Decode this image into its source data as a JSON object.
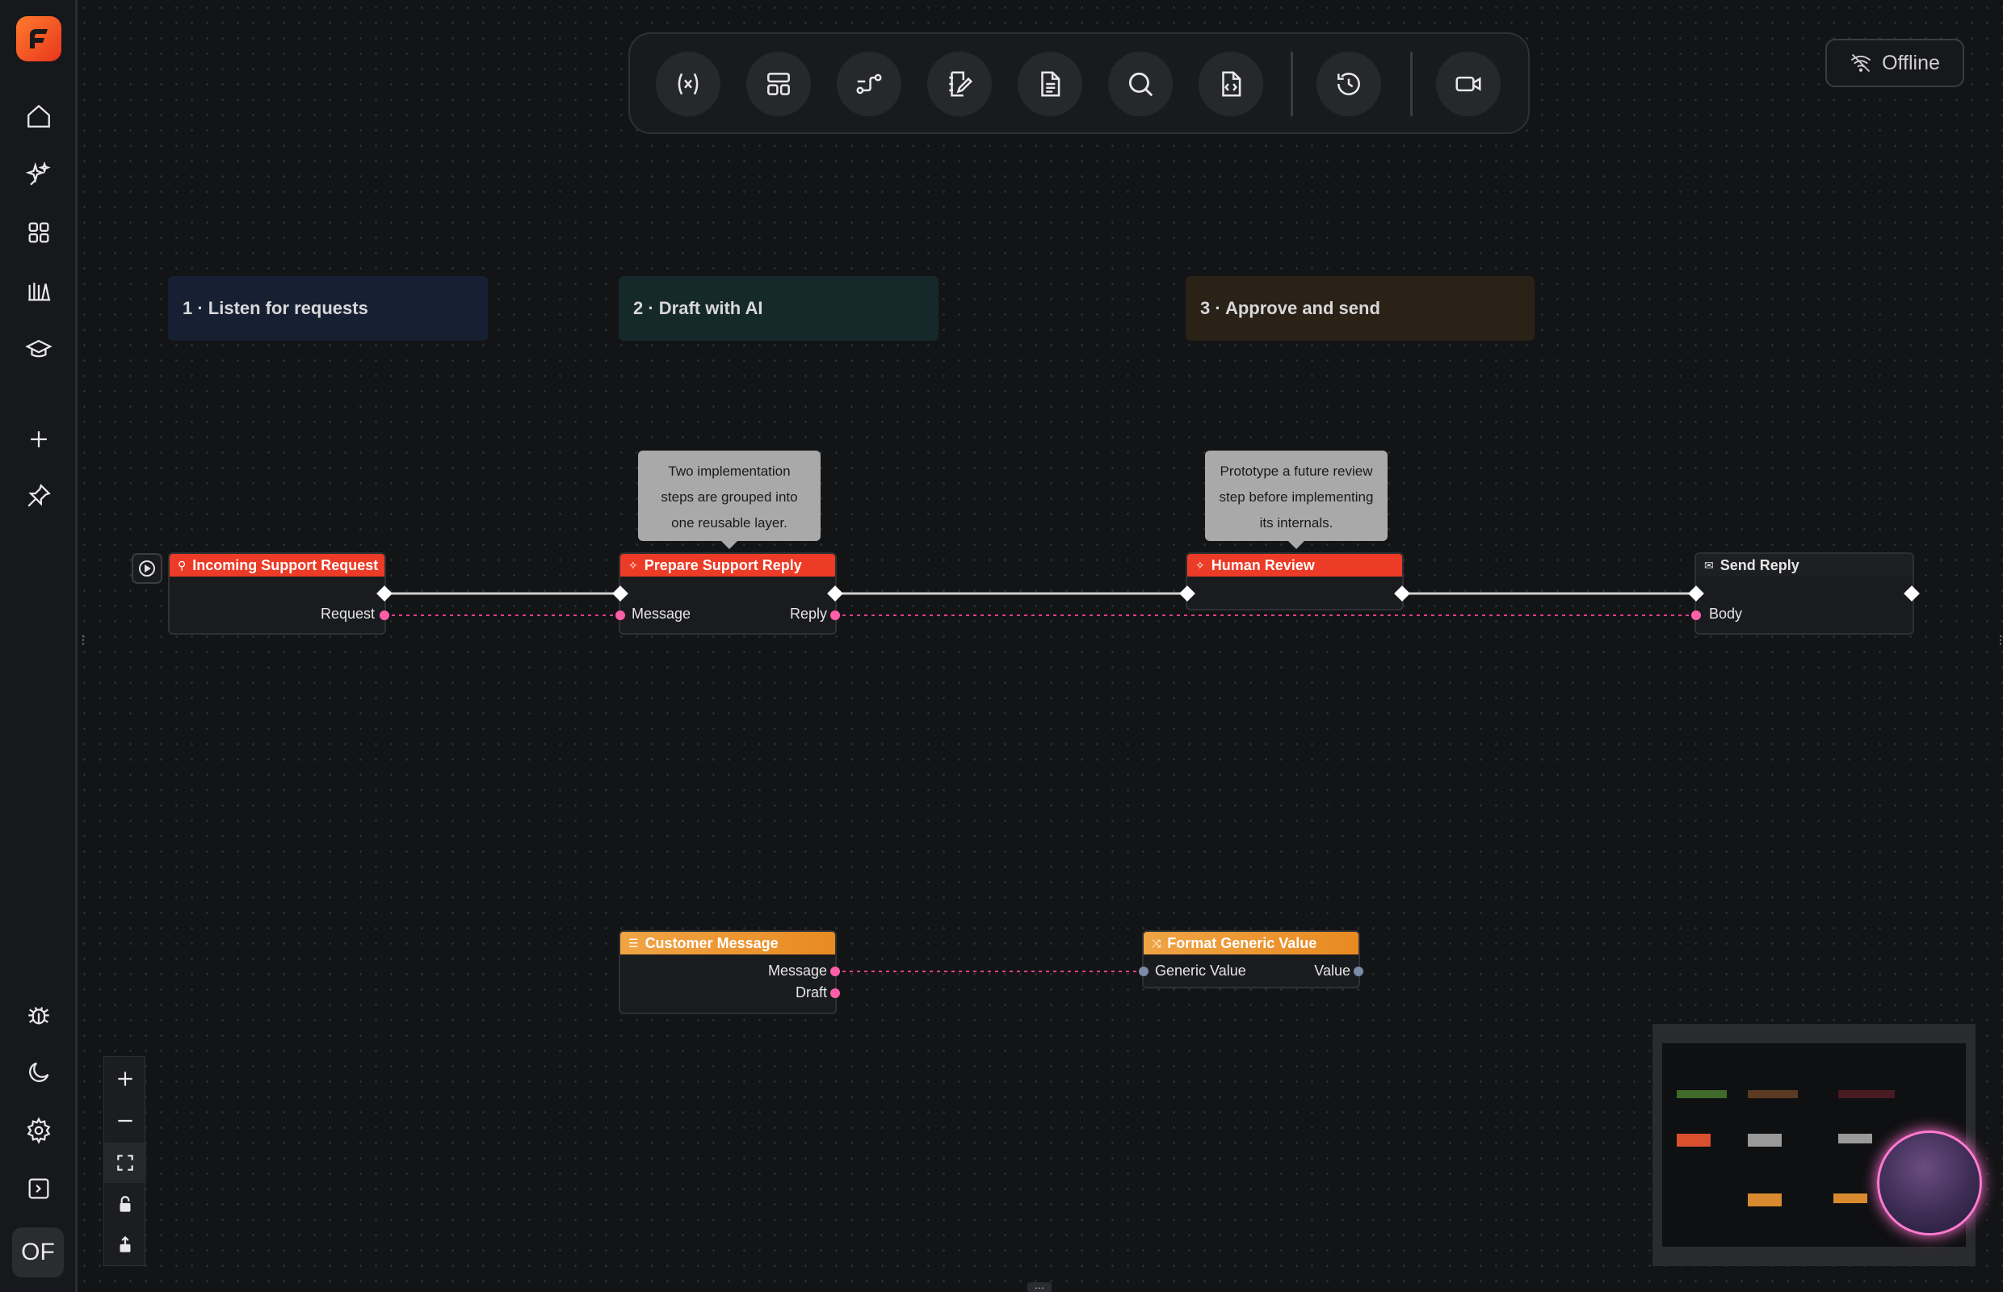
{
  "sidebar": {
    "items": [
      {
        "icon": "home-icon",
        "label": "Home"
      },
      {
        "icon": "sparkles-icon",
        "label": "AI"
      },
      {
        "icon": "grid-icon",
        "label": "Apps"
      },
      {
        "icon": "library-icon",
        "label": "Library"
      },
      {
        "icon": "graduation-cap-icon",
        "label": "Learn"
      },
      {
        "icon": "plus-icon",
        "label": "New"
      },
      {
        "icon": "pin-icon",
        "label": "Pinned"
      }
    ],
    "bottom": [
      {
        "icon": "bug-icon"
      },
      {
        "icon": "moon-icon"
      },
      {
        "icon": "gear-icon"
      },
      {
        "icon": "panel-expand-icon"
      }
    ],
    "avatar_initials": "OF"
  },
  "toolbar": {
    "buttons": [
      {
        "icon": "variable-icon"
      },
      {
        "icon": "layout-icon"
      },
      {
        "icon": "connection-icon"
      },
      {
        "icon": "notebook-edit-icon"
      },
      {
        "icon": "document-icon"
      },
      {
        "icon": "search-icon"
      },
      {
        "icon": "code-file-icon"
      },
      {
        "icon": "history-icon"
      },
      {
        "icon": "video-icon"
      }
    ]
  },
  "status": {
    "label": "Offline",
    "icon": "wifi-off-icon"
  },
  "groups": [
    {
      "label": "1 · Listen for requests",
      "color": "#172033"
    },
    {
      "label": "2 · Draft with AI",
      "color": "#16292a"
    },
    {
      "label": "3 · Approve and send",
      "color": "#2a2117"
    }
  ],
  "notes": [
    {
      "lines": [
        "Two implementation",
        "steps are grouped into",
        "one reusable layer."
      ]
    },
    {
      "lines": [
        "Prototype a future review",
        "step before implementing",
        "its internals."
      ]
    }
  ],
  "nodes": {
    "incoming": {
      "title": "Incoming Support Request",
      "outputs": [
        "Request"
      ]
    },
    "prepare": {
      "title": "Prepare Support Reply",
      "inputs": [
        "Message"
      ],
      "outputs": [
        "Reply"
      ]
    },
    "review": {
      "title": "Human Review"
    },
    "send": {
      "title": "Send Reply",
      "inputs": [
        "Body"
      ]
    },
    "customer": {
      "title": "Customer Message",
      "outputs": [
        "Message",
        "Draft"
      ]
    },
    "format": {
      "title": "Format Generic Value",
      "inputs": [
        "Generic Value"
      ],
      "outputs": [
        "Value"
      ]
    }
  },
  "colors": {
    "accent_red": "#ec3b26",
    "accent_orange": "#e88a22",
    "data_wire": "#e0408a",
    "exec_wire": "#d0d0d0"
  }
}
